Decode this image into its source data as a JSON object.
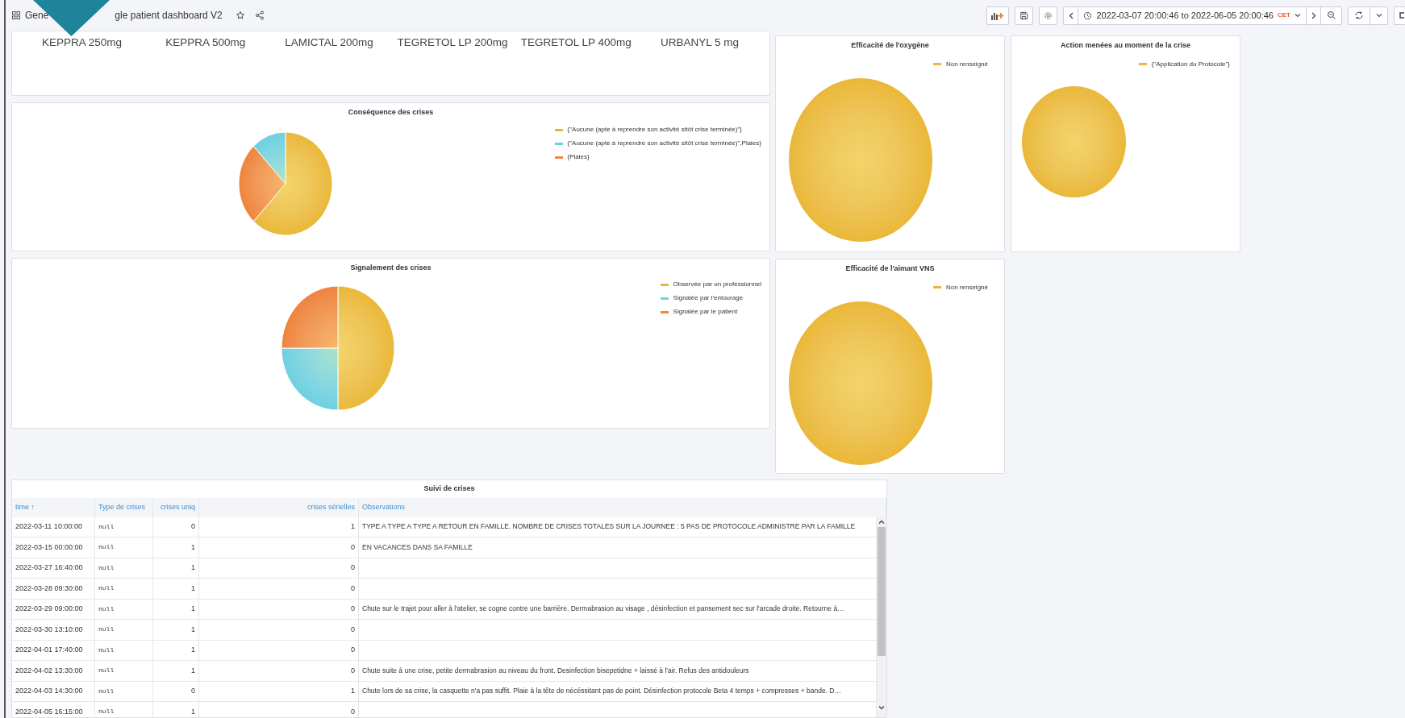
{
  "header": {
    "title_parts": [
      "Gene",
      "gle patient dashboard V2"
    ],
    "time_range": "2022-03-07 20:00:46 to 2022-06-05 20:00:46",
    "timezone": "CET"
  },
  "medications": [
    "KEPPRA 250mg",
    "KEPPRA 500mg",
    "LAMICTAL 200mg",
    "TEGRETOL LP 200mg",
    "TEGRETOL LP 400mg",
    "URBANYL 5 mg"
  ],
  "consequence": {
    "title": "Conséquence des crises",
    "legend": [
      {
        "label": "{\"Aucune (apte à reprendre son activité sitôt crise terminée)\"}",
        "color": "#eab839"
      },
      {
        "label": "{\"Aucune (apte à reprendre son activité sitôt crise terminée)\",Plaies}",
        "color": "#6ed0e0"
      },
      {
        "label": "{Plaies}",
        "color": "#ef843c"
      }
    ]
  },
  "signalement": {
    "title": "Signalement des crises",
    "legend": [
      {
        "label": "Observée par un professionnel",
        "color": "#eab839"
      },
      {
        "label": "Signalée par l'entourage",
        "color": "#6ed0e0"
      },
      {
        "label": "Signalée par le patient",
        "color": "#ef843c"
      }
    ]
  },
  "oxygen": {
    "title": "Efficacité de l'oxygène",
    "legend": [
      {
        "label": "Non renseigné",
        "color": "#eab839"
      }
    ]
  },
  "action": {
    "title": "Action menées au moment de la crise",
    "legend": [
      {
        "label": "{\"Application du Protocole\"}",
        "color": "#eab839"
      }
    ]
  },
  "vns": {
    "title": "Efficacité de l'aimant VNS",
    "legend": [
      {
        "label": "Non renseigné",
        "color": "#eab839"
      }
    ]
  },
  "table": {
    "title": "Suivi de crises",
    "columns": [
      "time ↑",
      "Type de crises",
      "crises uniq",
      "crises sérielles",
      "Observations"
    ],
    "rows": [
      [
        "2022-03-11 10:00:00",
        "null",
        "0",
        "1",
        "TYPE A TYPE A TYPE A RETOUR EN FAMILLE. NOMBRE DE CRISES TOTALES SUR LA JOURNEE : 5 PAS DE PROTOCOLE ADMINISTRE PAR LA FAMILLE"
      ],
      [
        "2022-03-15 00:00:00",
        "null",
        "1",
        "0",
        "EN VACANCES DANS SA FAMILLE"
      ],
      [
        "2022-03-27 16:40:00",
        "null",
        "1",
        "0",
        ""
      ],
      [
        "2022-03-28 09:30:00",
        "null",
        "1",
        "0",
        ""
      ],
      [
        "2022-03-29 09:00:00",
        "null",
        "1",
        "0",
        "Chute sur le trajet pour aller à l'atelier, se cogne contre une barrière. Dermabrasion au visage , désinfection et pansement sec sur l'arcade droite. Retourne à…"
      ],
      [
        "2022-03-30 13:10:00",
        "null",
        "1",
        "0",
        ""
      ],
      [
        "2022-04-01 17:40:00",
        "null",
        "1",
        "0",
        ""
      ],
      [
        "2022-04-02 13:30:00",
        "null",
        "1",
        "0",
        "Chute suite à une crise, petite dermabrasion au niveau du front. Desinfection bisepetidne + laissé à l'air. Refus des antidouleurs"
      ],
      [
        "2022-04-03 14:30:00",
        "null",
        "0",
        "1",
        "Chute lors de sa crise, la casquette n'a pas suffit. Plaie à la tête de nécéssitant pas de point. Désinfection protocole Beta 4 temps + compresses + bande. D…"
      ],
      [
        "2022-04-05 16:15:00",
        "null",
        "1",
        "0",
        ""
      ]
    ]
  }
}
